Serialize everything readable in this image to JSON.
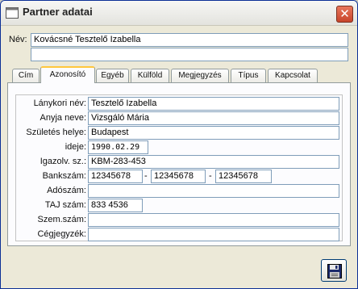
{
  "window": {
    "title": "Partner adatai"
  },
  "name_section": {
    "label": "Név:",
    "value": "Kovácsné Tesztelő Izabella",
    "value2": ""
  },
  "tabs": [
    {
      "label": "Cím"
    },
    {
      "label": "Azonosító"
    },
    {
      "label": "Egyéb"
    },
    {
      "label": "Külföld"
    },
    {
      "label": "Megjegyzés"
    },
    {
      "label": "Típus"
    },
    {
      "label": "Kapcsolat"
    }
  ],
  "active_tab": "Azonosító",
  "fields": {
    "maiden_name": {
      "label": "Lánykori név:",
      "value": "Tesztelő Izabella"
    },
    "mother_name": {
      "label": "Anyja neve:",
      "value": "Vizsgáló Mária"
    },
    "birth_place": {
      "label": "Születés helye:",
      "value": "Budapest"
    },
    "birth_date": {
      "label": "ideje:",
      "value": "1990.02.29"
    },
    "id_card": {
      "label": "Igazolv. sz.:",
      "value": "KBM-283-453"
    },
    "bank_account": {
      "label": "Bankszám:",
      "part1": "12345678",
      "part2": "12345678",
      "part3": "12345678",
      "separator": "-"
    },
    "tax_number": {
      "label": "Adószám:",
      "value": ""
    },
    "taj_number": {
      "label": "TAJ szám:",
      "value": "833 4536"
    },
    "personal_number": {
      "label": "Szem.szám:",
      "value": ""
    },
    "company_reg": {
      "label": "Cégjegyzék:",
      "value": ""
    }
  },
  "icons": {
    "title": "window-app-icon",
    "close": "close-icon",
    "save": "floppy-disk-icon"
  },
  "colors": {
    "tab_highlight": "#ffc73c",
    "input_border": "#7f9db9",
    "close_button": "#d85b3f"
  }
}
